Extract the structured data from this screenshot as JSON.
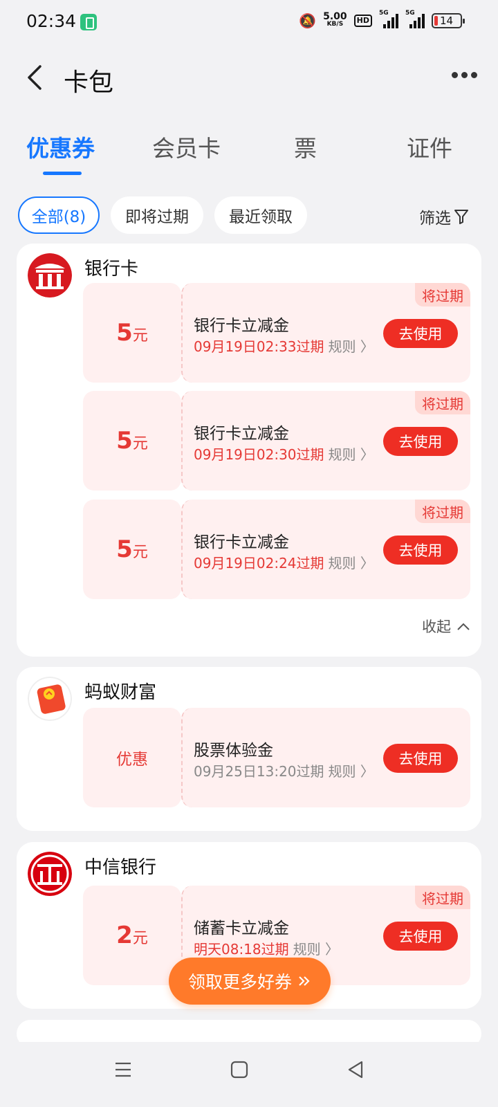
{
  "status_bar": {
    "time": "02:34",
    "net_speed_value": "5.00",
    "net_speed_unit": "KB/S",
    "hd_label": "HD",
    "sim1_label": "5G",
    "sim2_label": "5G",
    "battery": "14"
  },
  "header": {
    "title": "卡包"
  },
  "tabs": [
    {
      "label": "优惠券",
      "active": true
    },
    {
      "label": "会员卡",
      "active": false
    },
    {
      "label": "票",
      "active": false
    },
    {
      "label": "证件",
      "active": false
    }
  ],
  "filters": {
    "chips": [
      {
        "label": "全部(8)",
        "active": true
      },
      {
        "label": "即将过期",
        "active": false
      },
      {
        "label": "最近领取",
        "active": false
      }
    ],
    "filter_label": "筛选"
  },
  "cards": [
    {
      "brand": "银行卡",
      "coupons": [
        {
          "amount": "5",
          "unit": "元",
          "title": "银行卡立减金",
          "expire": "09月19日02:33过期",
          "rule": "规则",
          "button": "去使用",
          "tag": "将过期"
        },
        {
          "amount": "5",
          "unit": "元",
          "title": "银行卡立减金",
          "expire": "09月19日02:30过期",
          "rule": "规则",
          "button": "去使用",
          "tag": "将过期"
        },
        {
          "amount": "5",
          "unit": "元",
          "title": "银行卡立减金",
          "expire": "09月19日02:24过期",
          "rule": "规则",
          "button": "去使用",
          "tag": "将过期"
        }
      ],
      "collapse_label": "收起"
    },
    {
      "brand": "蚂蚁财富",
      "coupons": [
        {
          "amount_text": "优惠",
          "title": "股票体验金",
          "expire": "09月25日13:20过期",
          "rule": "规则",
          "button": "去使用"
        }
      ]
    },
    {
      "brand": "中信银行",
      "coupons": [
        {
          "amount": "2",
          "unit": "元",
          "title": "储蓄卡立减金",
          "expire": "明天08:18过期",
          "rule": "规则",
          "button": "去使用",
          "tag": "将过期"
        }
      ]
    }
  ],
  "floating_button": {
    "label": "领取更多好券"
  },
  "colors": {
    "accent_blue": "#1677ff",
    "coupon_red": "#e53935",
    "button_red": "#ee2e24",
    "coupon_bg": "#fff0f0",
    "floating_orange": "#ff7a2a"
  }
}
